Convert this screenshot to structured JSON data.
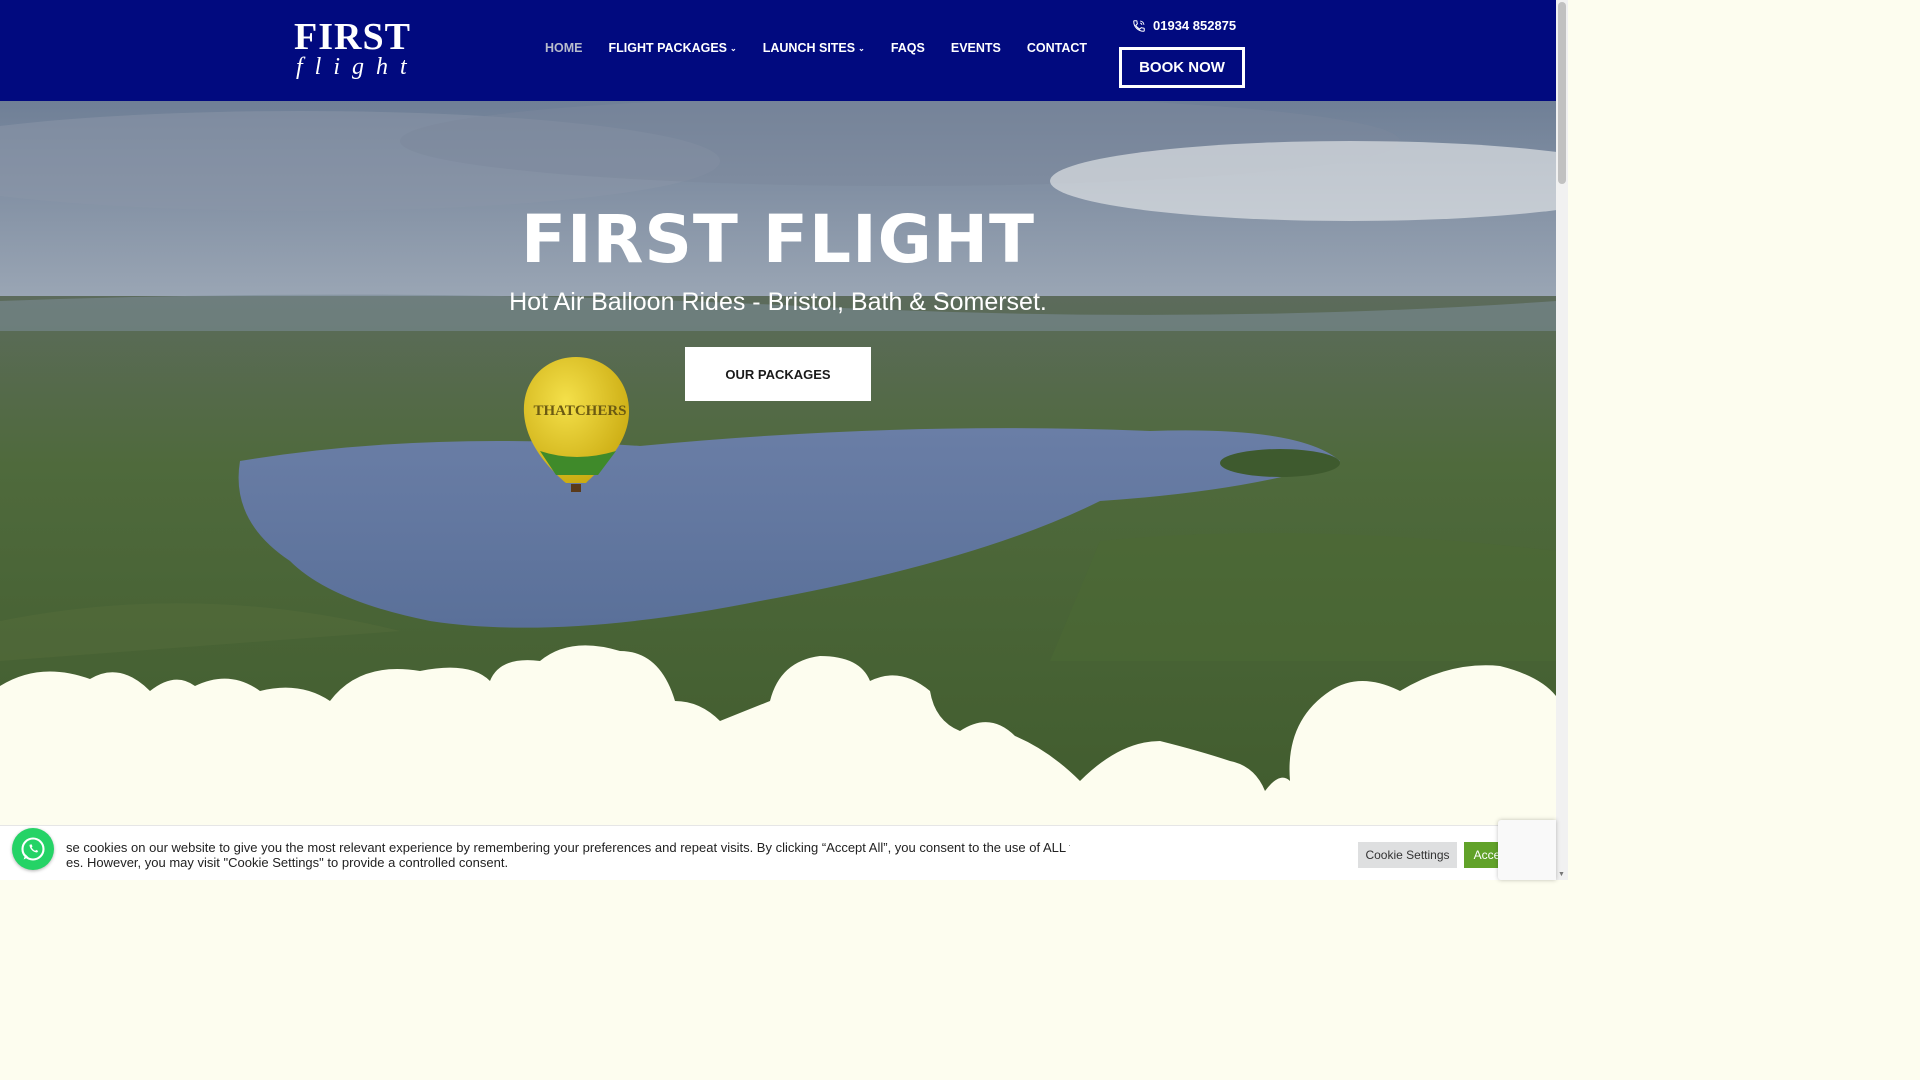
{
  "colors": {
    "header_bg": "#010a7f",
    "cloud": "#fdfdef",
    "accept_green": "#61a229",
    "whatsapp_green": "#25d366"
  },
  "logo": {
    "top": "FIRST",
    "bottom": "flight"
  },
  "nav": {
    "items": [
      {
        "label": "HOME",
        "active": true,
        "dropdown": false
      },
      {
        "label": "FLIGHT PACKAGES",
        "dropdown": true
      },
      {
        "label": "LAUNCH SITES",
        "dropdown": true
      },
      {
        "label": "FAQS",
        "dropdown": false
      },
      {
        "label": "EVENTS",
        "dropdown": false
      },
      {
        "label": "CONTACT",
        "dropdown": false
      }
    ],
    "chevron": "⌄"
  },
  "header": {
    "phone_icon": "phone-icon",
    "phone": "01934 852875",
    "book_label": "BOOK NOW"
  },
  "hero": {
    "title": "FIRST FLIGHT",
    "subtitle": "Hot Air Balloon Rides - Bristol, Bath & Somerset.",
    "button_label": "OUR PACKAGES",
    "balloon_text": "THATCHERS"
  },
  "cookie": {
    "text": "se cookies on our website to give you the most relevant experience by remembering your preferences and repeat visits. By clicking “Accept All”, you consent to the use of ALL the es. However, you may visit \"Cookie Settings\" to provide a controlled consent.",
    "line1": "se cookies on our website to give you the most relevant experience by remembering your preferences and repeat visits. By clicking “Accept All”, you consent to the use of ALL the",
    "line2": "es. However, you may visit \"Cookie Settings\" to provide a controlled consent.",
    "settings_label": "Cookie Settings",
    "accept_label": "Accept All"
  },
  "widgets": {
    "whatsapp_icon": "whatsapp-icon",
    "recaptcha_icon": "recaptcha-icon"
  }
}
